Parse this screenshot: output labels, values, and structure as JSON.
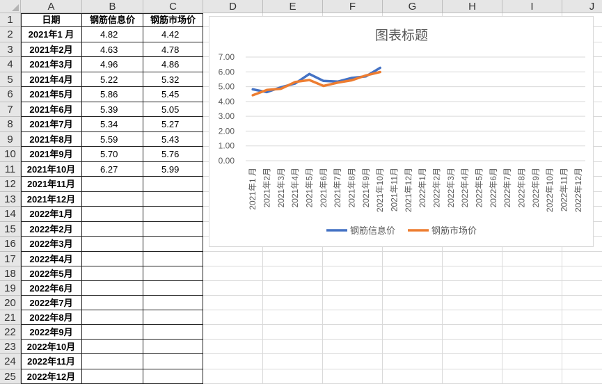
{
  "sheet": {
    "columns": [
      "A",
      "B",
      "C",
      "D",
      "E",
      "F",
      "G",
      "H",
      "I",
      "J"
    ],
    "rows": [
      "1",
      "2",
      "3",
      "4",
      "5",
      "6",
      "7",
      "8",
      "9",
      "10",
      "11",
      "12",
      "13",
      "14",
      "15",
      "16",
      "17",
      "18",
      "19",
      "20",
      "21",
      "22",
      "23",
      "24",
      "25"
    ]
  },
  "table": {
    "headers": [
      "日期",
      "钢筋信息价",
      "钢筋市场价"
    ],
    "rows": [
      [
        "2021年1 月",
        "4.82",
        "4.42"
      ],
      [
        "2021年2月",
        "4.63",
        "4.78"
      ],
      [
        "2021年3月",
        "4.96",
        "4.86"
      ],
      [
        "2021年4月",
        "5.22",
        "5.32"
      ],
      [
        "2021年5月",
        "5.86",
        "5.45"
      ],
      [
        "2021年6月",
        "5.39",
        "5.05"
      ],
      [
        "2021年7月",
        "5.34",
        "5.27"
      ],
      [
        "2021年8月",
        "5.59",
        "5.43"
      ],
      [
        "2021年9月",
        "5.70",
        "5.76"
      ],
      [
        "2021年10月",
        "6.27",
        "5.99"
      ],
      [
        "2021年11月",
        "",
        ""
      ],
      [
        "2021年12月",
        "",
        ""
      ],
      [
        "2022年1月",
        "",
        ""
      ],
      [
        "2022年2月",
        "",
        ""
      ],
      [
        "2022年3月",
        "",
        ""
      ],
      [
        "2022年4月",
        "",
        ""
      ],
      [
        "2022年5月",
        "",
        ""
      ],
      [
        "2022年6月",
        "",
        ""
      ],
      [
        "2022年7月",
        "",
        ""
      ],
      [
        "2022年8月",
        "",
        ""
      ],
      [
        "2022年9月",
        "",
        ""
      ],
      [
        "2022年10月",
        "",
        ""
      ],
      [
        "2022年11月",
        "",
        ""
      ],
      [
        "2022年12月",
        "",
        ""
      ]
    ]
  },
  "chart_data": {
    "type": "line",
    "title": "图表标题",
    "categories": [
      "2021年1 月",
      "2021年2月",
      "2021年3月",
      "2021年4月",
      "2021年5月",
      "2021年6月",
      "2021年7月",
      "2021年8月",
      "2021年9月",
      "2021年10月",
      "2021年11月",
      "2021年12月",
      "2022年1月",
      "2022年2月",
      "2022年3月",
      "2022年4月",
      "2022年5月",
      "2022年6月",
      "2022年7月",
      "2022年8月",
      "2022年9月",
      "2022年10月",
      "2022年11月",
      "2022年12月"
    ],
    "series": [
      {
        "name": "钢筋信息价",
        "color": "#4472C4",
        "values": [
          4.82,
          4.63,
          4.96,
          5.22,
          5.86,
          5.39,
          5.34,
          5.59,
          5.7,
          6.27,
          null,
          null,
          null,
          null,
          null,
          null,
          null,
          null,
          null,
          null,
          null,
          null,
          null,
          null
        ]
      },
      {
        "name": "钢筋市场价",
        "color": "#ED7D31",
        "values": [
          4.42,
          4.78,
          4.86,
          5.32,
          5.45,
          5.05,
          5.27,
          5.43,
          5.76,
          5.99,
          null,
          null,
          null,
          null,
          null,
          null,
          null,
          null,
          null,
          null,
          null,
          null,
          null,
          null
        ]
      }
    ],
    "yticks": [
      "0.00",
      "1.00",
      "2.00",
      "3.00",
      "4.00",
      "5.00",
      "6.00",
      "7.00"
    ],
    "ylim": [
      0,
      7
    ],
    "grid": true,
    "legend": "bottom"
  }
}
